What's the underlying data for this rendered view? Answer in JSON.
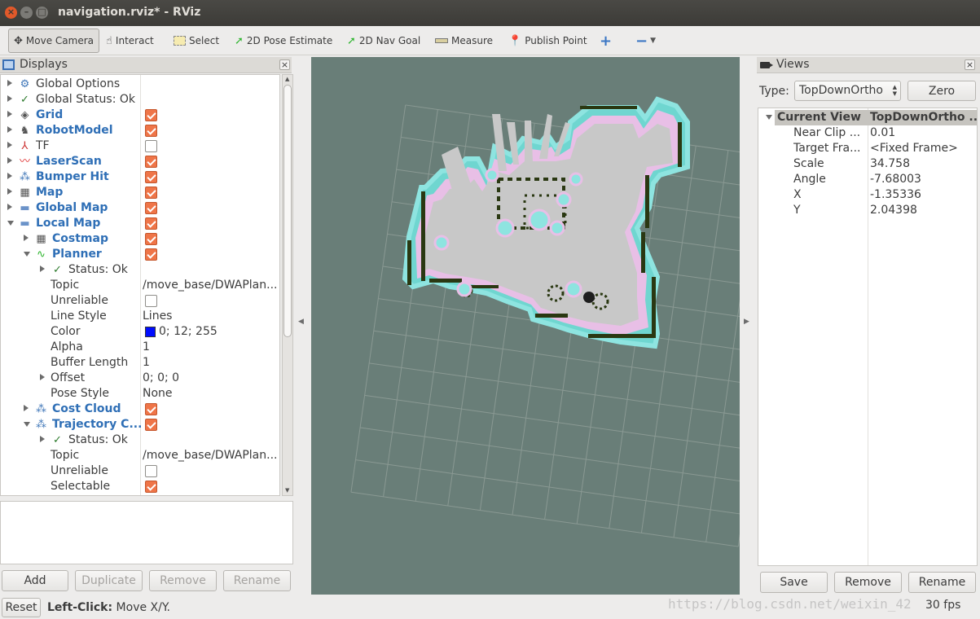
{
  "window": {
    "title": "navigation.rviz* - RViz"
  },
  "toolbar": {
    "tools": [
      {
        "label": "Move Camera",
        "icon": "move-camera-icon"
      },
      {
        "label": "Interact",
        "icon": "hand-icon"
      },
      {
        "label": "Select",
        "icon": "select-box-icon"
      },
      {
        "label": "2D Pose Estimate",
        "icon": "green-arrow-icon"
      },
      {
        "label": "2D Nav Goal",
        "icon": "green-arrow-icon"
      },
      {
        "label": "Measure",
        "icon": "ruler-icon"
      },
      {
        "label": "Publish Point",
        "icon": "map-pin-icon"
      }
    ]
  },
  "displays": {
    "title": "Displays",
    "rows": [
      {
        "label": "Global Options",
        "value": ""
      },
      {
        "label": "Global Status: Ok",
        "value": ""
      },
      {
        "label": "Grid",
        "value": ""
      },
      {
        "label": "RobotModel",
        "value": ""
      },
      {
        "label": "TF",
        "value": ""
      },
      {
        "label": "LaserScan",
        "value": ""
      },
      {
        "label": "Bumper Hit",
        "value": ""
      },
      {
        "label": "Map",
        "value": ""
      },
      {
        "label": "Global Map",
        "value": ""
      },
      {
        "label": "Local Map",
        "value": ""
      },
      {
        "label": "Costmap",
        "value": ""
      },
      {
        "label": "Planner",
        "value": ""
      },
      {
        "label": "Status: Ok",
        "value": ""
      },
      {
        "label": "Topic",
        "value": "/move_base/DWAPlan..."
      },
      {
        "label": "Unreliable",
        "value": ""
      },
      {
        "label": "Line Style",
        "value": "Lines"
      },
      {
        "label": "Color",
        "value": "0; 12; 255"
      },
      {
        "label": "Alpha",
        "value": "1"
      },
      {
        "label": "Buffer Length",
        "value": "1"
      },
      {
        "label": "Offset",
        "value": "0; 0; 0"
      },
      {
        "label": "Pose Style",
        "value": "None"
      },
      {
        "label": "Cost Cloud",
        "value": ""
      },
      {
        "label": "Trajectory C...",
        "value": ""
      },
      {
        "label": "Status: Ok",
        "value": ""
      },
      {
        "label": "Topic",
        "value": "/move_base/DWAPlan..."
      },
      {
        "label": "Unreliable",
        "value": ""
      },
      {
        "label": "Selectable",
        "value": ""
      }
    ],
    "buttons": {
      "add": "Add",
      "duplicate": "Duplicate",
      "remove": "Remove",
      "rename": "Rename"
    }
  },
  "views": {
    "title": "Views",
    "type_label": "Type:",
    "type_value": "TopDownOrtho",
    "zero_label": "Zero",
    "current_view": {
      "label": "Current View",
      "value": "TopDownOrtho ..."
    },
    "props": [
      {
        "key": "Near Clip ...",
        "value": "0.01"
      },
      {
        "key": "Target Fra...",
        "value": "<Fixed Frame>"
      },
      {
        "key": "Scale",
        "value": "34.758"
      },
      {
        "key": "Angle",
        "value": "-7.68003"
      },
      {
        "key": "X",
        "value": "-1.35336"
      },
      {
        "key": "Y",
        "value": "2.04398"
      }
    ],
    "buttons": {
      "save": "Save",
      "remove": "Remove",
      "rename": "Rename"
    }
  },
  "statusbar": {
    "reset_label": "Reset",
    "hint_bold": "Left-Click:",
    "hint_text": " Move X/Y.",
    "fps": "30 fps",
    "watermark": "https://blog.csdn.net/weixin_42"
  },
  "colors": {
    "view_background": "#697e78",
    "map_free": "#c8c8c8",
    "costmap_inflation": "#8ee4e0",
    "costmap_lethal": "#2a3812",
    "accent_check": "#ef7548",
    "planner_color": "#000cff"
  }
}
